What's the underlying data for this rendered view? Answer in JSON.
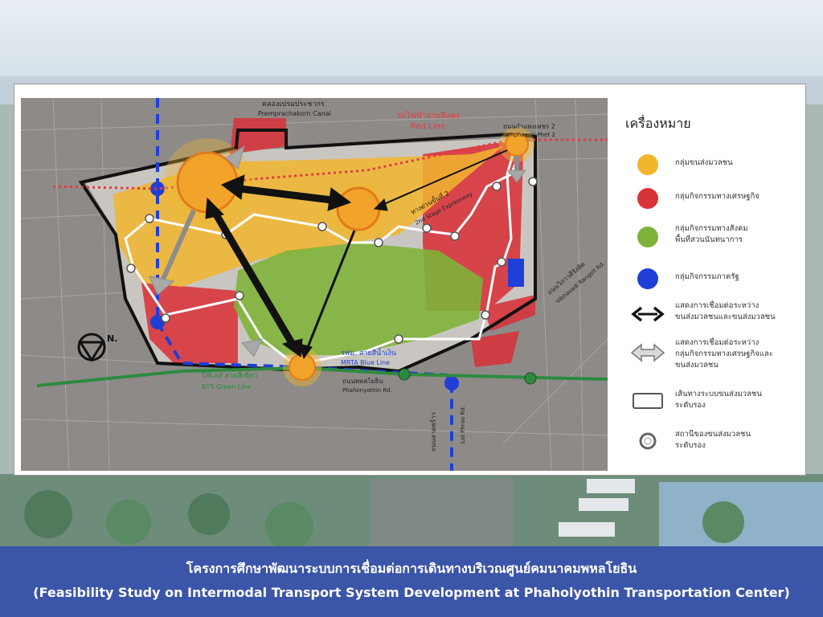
{
  "colors": {
    "footer_bg": "#3b55a8",
    "mass_transit": "#f2b52e",
    "economic": "#d8333a",
    "green_space": "#7fb23a",
    "government": "#1f3fd8",
    "red_line": "#e23d3d",
    "blue_line": "#1f3fd8",
    "green_line": "#2e8a3e"
  },
  "map": {
    "labels": {
      "canal_th": "คลองเปรมประชากร",
      "canal_en": "Premprachakorn Canal",
      "red_line_th": "รถไฟฟ้าสายสีแดง",
      "red_line_en": "Red Line",
      "kamphaeng_th": "ถนนกำแพงเพชร 2",
      "kamphaeng_en": "Kamphaeng-Phet 2",
      "expressway_th": "ทางด่วนขั้นที่ 2",
      "expressway_en": "2nd Stage Expressway",
      "vibhavadi_th": "ถนนวิภาวดีรังสิต",
      "vibhavadi_en": "Vibhavadi Rangsit Rd.",
      "mrt_th": "รฟม. สายสีน้ำเงิน",
      "mrt_en": "MRTA Blue Line",
      "phahon_th": "ถนนพหลโยธิน",
      "phahon_en": "Phahonyothin Rd.",
      "bts_th": "บีทีเอส สายสีเขียว",
      "bts_en": "BTS Green Line",
      "latphrao_th": "ถนนลาดพร้าว",
      "latphrao_en": "Lat Phrao Rd.",
      "north": "N."
    }
  },
  "legend": {
    "title": "เครื่องหมาย",
    "items": [
      {
        "text": "กลุ่มขนส่งมวลชน",
        "symbol": "yellow-circle"
      },
      {
        "text": "กลุ่มกิจกรรมทางเศรษฐกิจ",
        "symbol": "red-circle"
      },
      {
        "text": "กลุ่มกิจกรรมทางสังคม\nพื้นที่สวนนันทนาการ",
        "symbol": "green-circle"
      },
      {
        "text": "กลุ่มกิจกรรมภาครัฐ",
        "symbol": "blue-circle"
      },
      {
        "text": "แสดงการเชื่อมต่อระหว่าง\nขนส่งมวลชนและขนส่งมวลชน",
        "symbol": "black-double-arrow"
      },
      {
        "text": "แสดงการเชื่อมต่อระหว่าง\nกลุ่มกิจกรรมทางเศรษฐกิจและ\nขนส่งมวลชน",
        "symbol": "gray-double-arrow"
      },
      {
        "text": "เส้นทางระบบขนส่งมวลชน\nระดับรอง",
        "symbol": "rounded-rectangle"
      },
      {
        "text": "สถานีของขนส่งมวลชน\nระดับรอง",
        "symbol": "station-ring"
      }
    ]
  },
  "footer": {
    "title_th": "โครงการศึกษาพัฒนาระบบการเชื่อมต่อการเดินทางบริเวณศูนย์คมนาคมพหลโยธิน",
    "title_en": "(Feasibility Study on Intermodal Transport System Development at Phaholyothin Transportation Center)"
  }
}
